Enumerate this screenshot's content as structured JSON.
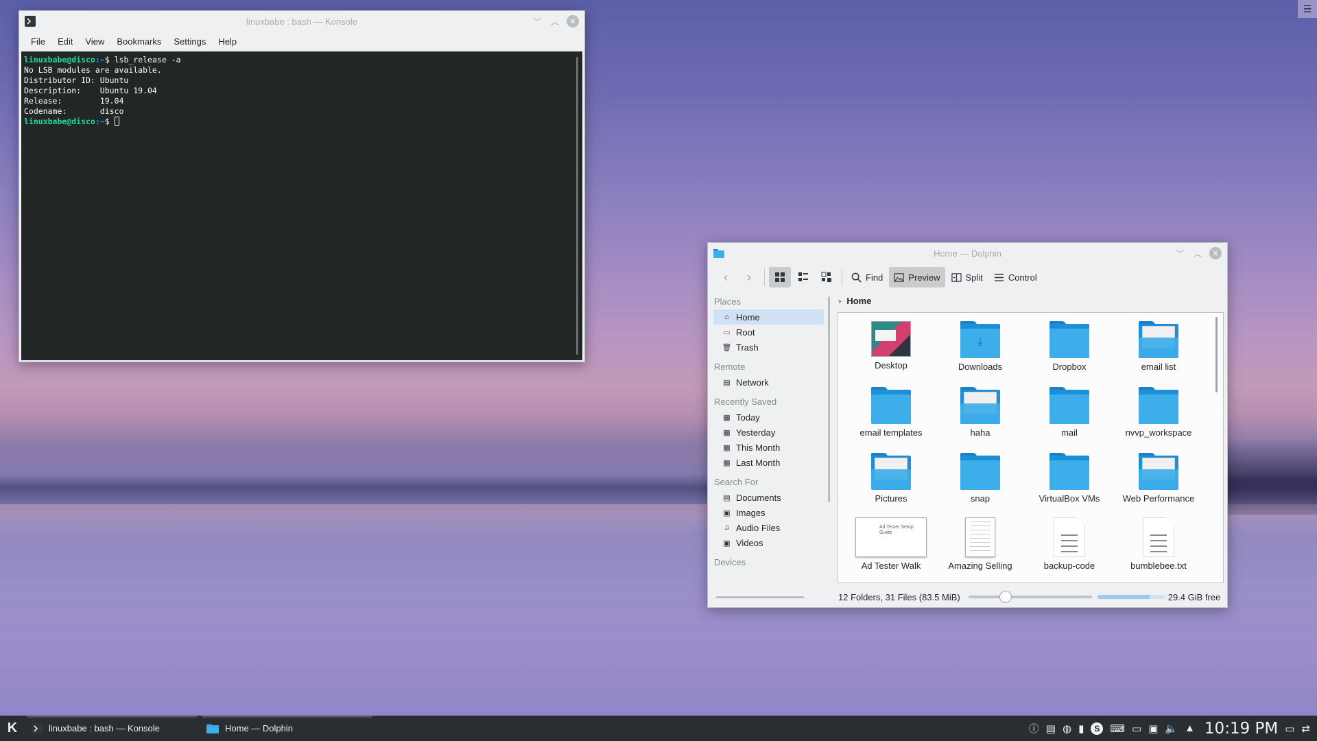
{
  "desktop": {
    "corner_button_icon": "hamburger-icon"
  },
  "konsole": {
    "title": "linuxbabe : bash — Konsole",
    "menu": [
      "File",
      "Edit",
      "View",
      "Bookmarks",
      "Settings",
      "Help"
    ],
    "terminal": {
      "prompt_user": "linuxbabe@disco",
      "prompt_path": ":~",
      "prompt_symbol": "$",
      "command": "lsb_release -a",
      "output": [
        "No LSB modules are available.",
        "Distributor ID: Ubuntu",
        "Description:    Ubuntu 19.04",
        "Release:        19.04",
        "Codename:       disco"
      ]
    }
  },
  "dolphin": {
    "title": "Home — Dolphin",
    "toolbar": {
      "find": "Find",
      "preview": "Preview",
      "split": "Split",
      "control": "Control"
    },
    "places": {
      "places_header": "Places",
      "places_items": [
        "Home",
        "Root",
        "Trash"
      ],
      "remote_header": "Remote",
      "remote_items": [
        "Network"
      ],
      "recent_header": "Recently Saved",
      "recent_items": [
        "Today",
        "Yesterday",
        "This Month",
        "Last Month"
      ],
      "search_header": "Search For",
      "search_items": [
        "Documents",
        "Images",
        "Audio Files",
        "Videos"
      ],
      "devices_header": "Devices"
    },
    "breadcrumb": "Home",
    "files": [
      {
        "name": "Desktop",
        "kind": "desktop"
      },
      {
        "name": "Downloads",
        "kind": "folder-download"
      },
      {
        "name": "Dropbox",
        "kind": "folder"
      },
      {
        "name": "email list",
        "kind": "folder-thumb"
      },
      {
        "name": "email templates",
        "kind": "folder"
      },
      {
        "name": "haha",
        "kind": "folder-thumb"
      },
      {
        "name": "mail",
        "kind": "folder"
      },
      {
        "name": "nvvp_workspace",
        "kind": "folder"
      },
      {
        "name": "Pictures",
        "kind": "folder-thumb"
      },
      {
        "name": "snap",
        "kind": "folder"
      },
      {
        "name": "VirtualBox VMs",
        "kind": "folder"
      },
      {
        "name": "Web Performance",
        "kind": "folder-thumb"
      },
      {
        "name": "Ad Tester Walk",
        "kind": "doc-thumb"
      },
      {
        "name": "Amazing Selling",
        "kind": "page-thumb"
      },
      {
        "name": "backup-code",
        "kind": "text"
      },
      {
        "name": "bumblebee.txt",
        "kind": "text"
      }
    ],
    "doc_thumb_text": "Ad Tester Setup Guide",
    "status": {
      "summary": "12 Folders, 31 Files (83.5 MiB)",
      "free": "29.4 GiB free",
      "used_fraction": 0.78,
      "zoom_fraction": 0.28
    }
  },
  "taskbar": {
    "tasks": [
      {
        "label": "linuxbabe : bash — Konsole",
        "icon": "terminal-icon"
      },
      {
        "label": "Home — Dolphin",
        "icon": "folder-icon"
      }
    ],
    "tray_icons": [
      "info-icon",
      "clipboard-icon",
      "update-icon",
      "usb-icon",
      "skype-icon",
      "keyboard-icon",
      "display-icon",
      "network-icon",
      "volume-icon",
      "expand-tray-icon"
    ],
    "clock": "10:19 PM"
  }
}
